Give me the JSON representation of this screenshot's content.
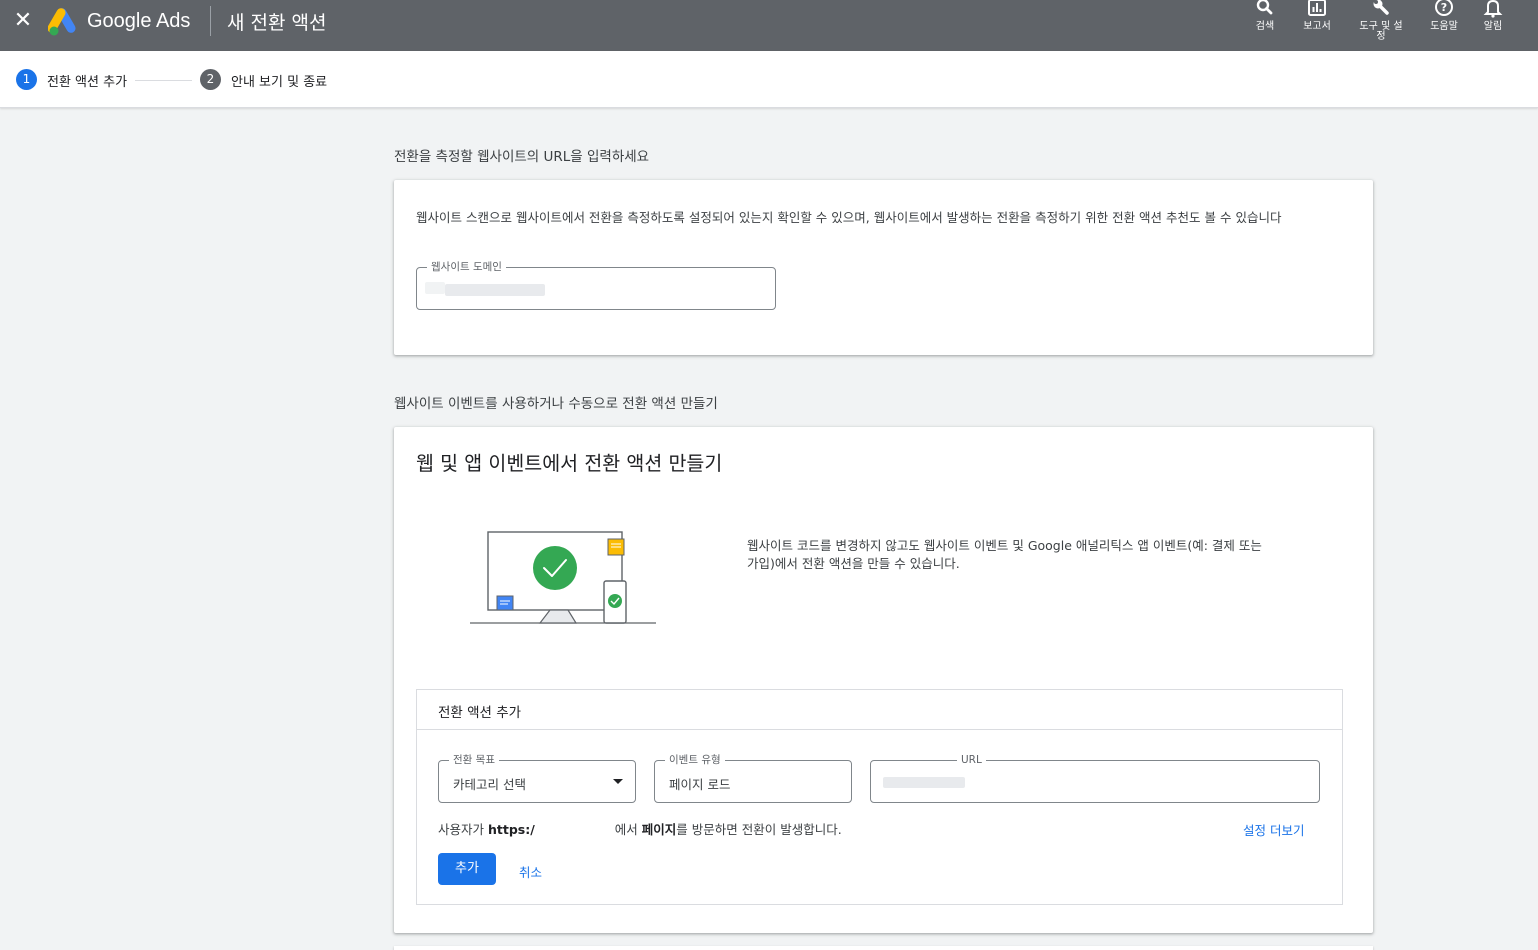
{
  "header": {
    "close_label": "✕",
    "brand": "Google Ads",
    "title": "새 전환 액션",
    "tools": [
      {
        "icon": "search-icon",
        "label": "검색"
      },
      {
        "icon": "reports-icon",
        "label": "보고서"
      },
      {
        "icon": "wrench-icon",
        "label": "도구 및 설정"
      },
      {
        "icon": "help-icon",
        "label": "도움말"
      },
      {
        "icon": "bell-icon",
        "label": "알림"
      }
    ]
  },
  "stepper": {
    "steps": [
      {
        "number": "1",
        "label": "전환 액션 추가",
        "active": true
      },
      {
        "number": "2",
        "label": "안내 보기 및 종료",
        "active": false
      }
    ]
  },
  "url_section": {
    "heading": "전환을 측정할 웹사이트의 URL을 입력하세요",
    "description": "웹사이트 스캔으로 웹사이트에서 전환을 측정하도록 설정되어 있는지 확인할 수 있으며, 웹사이트에서 발생하는 전환을 측정하기 위한 전환 액션 추천도 볼 수 있습니다",
    "domain_field_label": "웹사이트 도메인"
  },
  "events_section": {
    "heading": "웹사이트 이벤트를 사용하거나 수동으로 전환 액션 만들기",
    "card_title": "웹 및 앱 이벤트에서 전환 액션 만들기",
    "info": "웹사이트 코드를 변경하지 않고도 웹사이트 이벤트 및 Google 애널리틱스 앱 이벤트(예: 결제 또는 가입)에서 전환 액션을 만들 수 있습니다.",
    "panel": {
      "title": "전환 액션 추가",
      "goal_label": "전환 목표",
      "goal_value": "카테고리 선택",
      "event_type_label": "이벤트 유형",
      "event_type_value": "페이지 로드",
      "url_label": "URL",
      "sentence_prefix": "사용자가 ",
      "sentence_url": "https:/",
      "sentence_mid": "에서 ",
      "sentence_bold": "페이지",
      "sentence_suffix": "를 방문하면 전환이 발생합니다.",
      "more_settings": "설정 더보기",
      "add_button": "추가",
      "cancel_button": "취소"
    }
  },
  "colors": {
    "topbar": "#5f6368",
    "primary": "#1a73e8",
    "inactive_step": "#5f6368",
    "success_green": "#34a853",
    "note_yellow": "#fbbc04"
  }
}
